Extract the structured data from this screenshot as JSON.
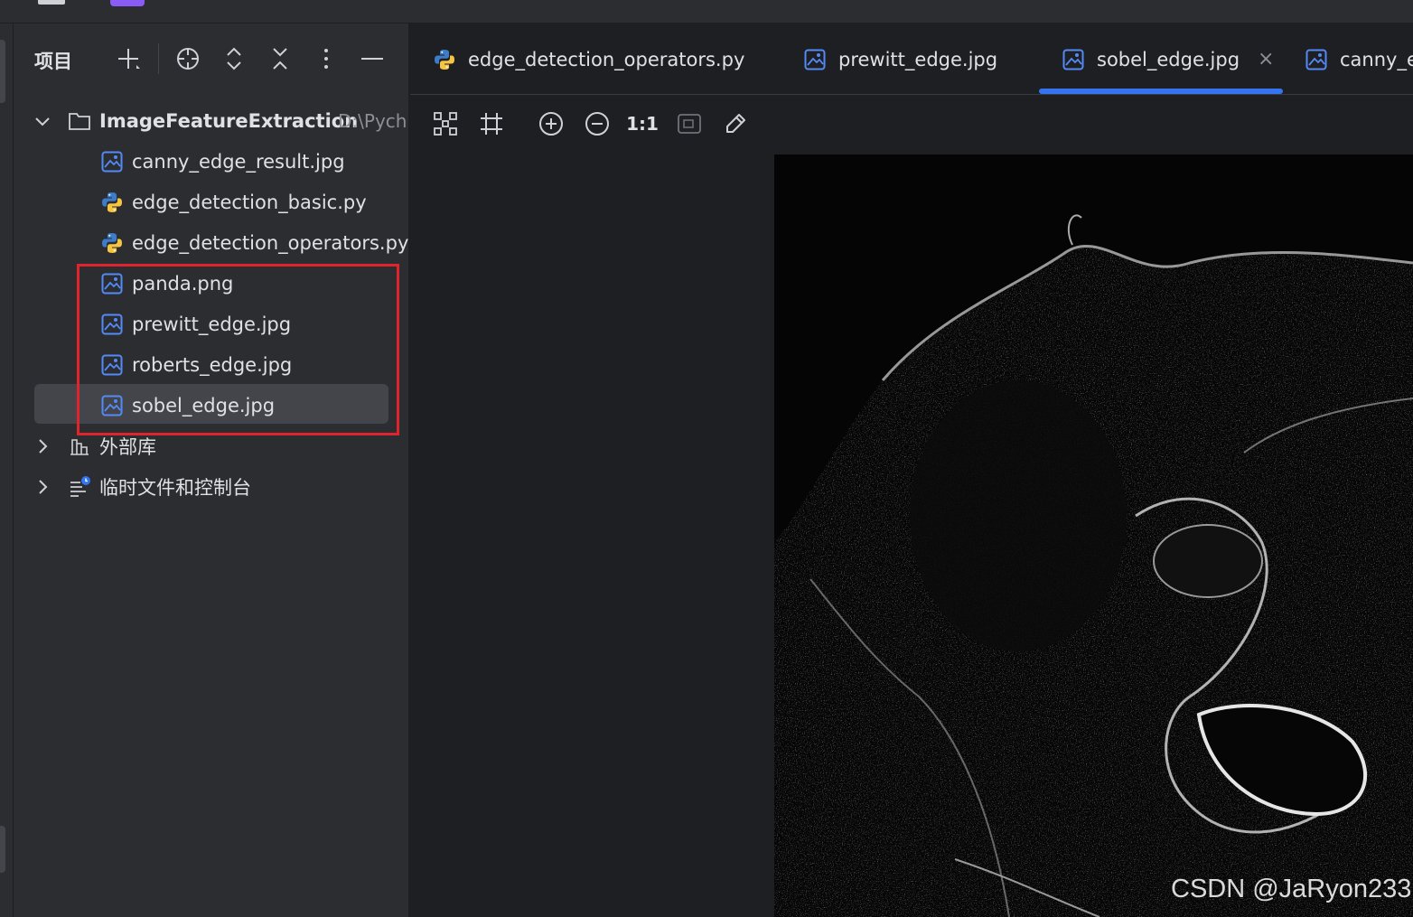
{
  "project_panel": {
    "title": "项目",
    "root": {
      "name": "ImageFeatureExtraction",
      "path": "D:\\Pych"
    },
    "files": [
      {
        "name": "canny_edge_result.jpg",
        "type": "image"
      },
      {
        "name": "edge_detection_basic.py",
        "type": "python"
      },
      {
        "name": "edge_detection_operators.py",
        "type": "python"
      },
      {
        "name": "panda.png",
        "type": "image"
      },
      {
        "name": "prewitt_edge.jpg",
        "type": "image"
      },
      {
        "name": "roberts_edge.jpg",
        "type": "image"
      },
      {
        "name": "sobel_edge.jpg",
        "type": "image",
        "selected": true
      }
    ],
    "external_libraries": "外部库",
    "scratches": "临时文件和控制台"
  },
  "editor": {
    "tabs": [
      {
        "label": "edge_detection_operators.py",
        "type": "python"
      },
      {
        "label": "prewitt_edge.jpg",
        "type": "image"
      },
      {
        "label": "sobel_edge.jpg",
        "type": "image",
        "active": true,
        "close": "×"
      },
      {
        "label": "canny_e",
        "type": "image"
      }
    ],
    "toolbar": {
      "actual_size_label": "1:1"
    }
  },
  "watermark": "CSDN @JaRyon233",
  "colors": {
    "accent": "#3574f0",
    "highlight_box": "#e0242e",
    "image_icon": "#548af7"
  }
}
